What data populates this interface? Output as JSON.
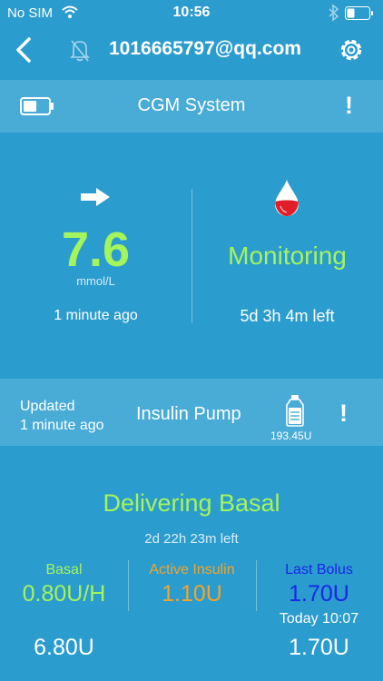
{
  "status_bar": {
    "carrier": "No SIM",
    "time": "10:56"
  },
  "nav": {
    "title": "1016665797@qq.com"
  },
  "cgm": {
    "title": "CGM System",
    "alert": "!",
    "glucose_value": "7.6",
    "glucose_unit": "mmol/L",
    "updated": "1 minute ago",
    "status": "Monitoring",
    "time_left": "5d 3h 4m left"
  },
  "pump": {
    "updated_line1": "Updated",
    "updated_line2": "1 minute ago",
    "title": "Insulin Pump",
    "reservoir": "193.45U",
    "alert": "!",
    "delivery_status": "Delivering Basal",
    "basal_time_left": "2d 22h 23m left",
    "basal_label": "Basal",
    "basal_value": "0.80U/H",
    "active_insulin_label": "Active Insulin",
    "active_insulin_value": "1.10U",
    "last_bolus_label": "Last Bolus",
    "last_bolus_value": "1.70U",
    "last_bolus_time": "Today 10:07",
    "total_basal": "6.80U",
    "total_bolus": "1.70U"
  },
  "colors": {
    "background": "#2b9cce",
    "panel": "#48acd7",
    "glucose_green": "#a5f45c",
    "active_insulin_orange": "#f4a42a",
    "last_bolus_blue": "#1826e8",
    "blood_red": "#e21d2a"
  },
  "icons": {
    "back": "chevron-left-icon",
    "alarm_muted": "bell-off-icon",
    "settings": "gear-icon",
    "transmitter_battery": "battery-icon",
    "trend": "arrow-right-icon",
    "sensor": "blood-drop-icon",
    "reservoir": "insulin-bottle-icon"
  }
}
